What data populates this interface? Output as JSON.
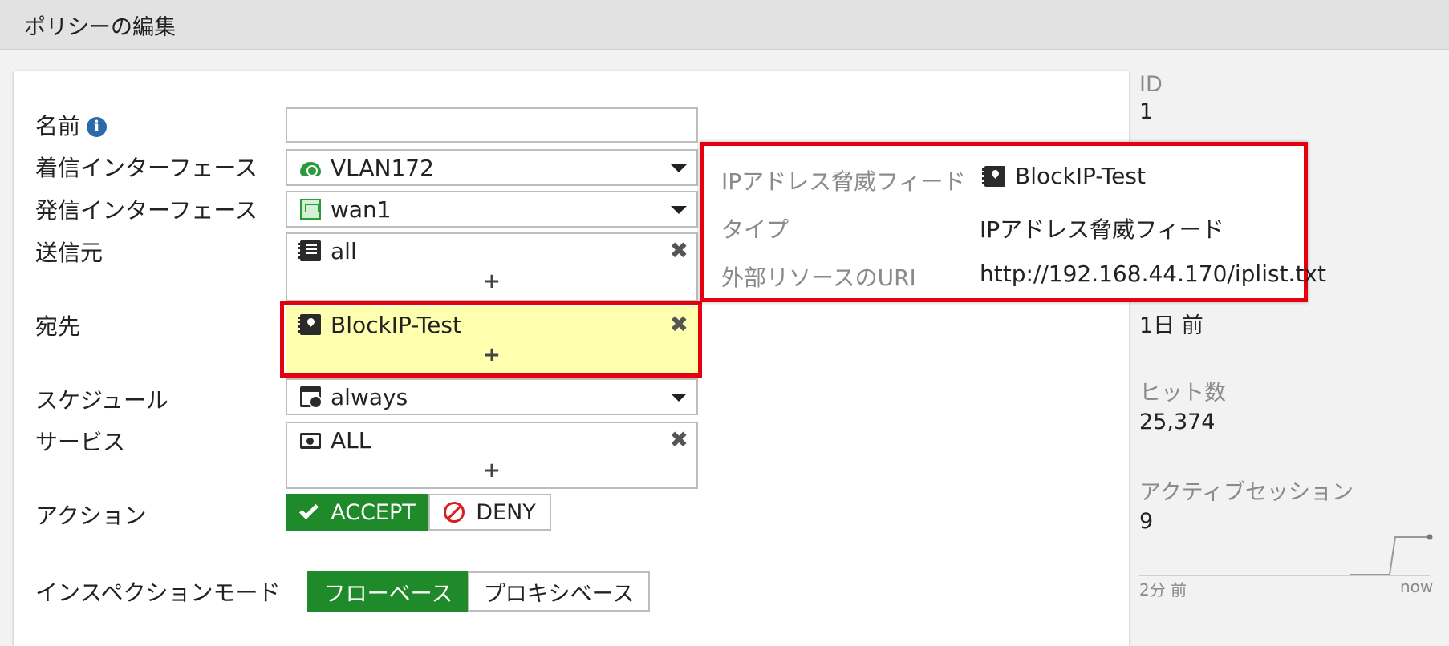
{
  "window": {
    "title": "ポリシーの編集"
  },
  "form": {
    "name": {
      "label": "名前",
      "value": ""
    },
    "incoming_interface": {
      "label": "着信インターフェース",
      "value": "VLAN172",
      "icon": "cloud-icon"
    },
    "outgoing_interface": {
      "label": "発信インターフェース",
      "value": "wan1",
      "icon": "port-icon"
    },
    "source": {
      "label": "送信元",
      "value": "all",
      "icon": "address-book-icon",
      "add": "+"
    },
    "destination": {
      "label": "宛先",
      "value": "BlockIP-Test",
      "icon": "threat-feed-icon",
      "add": "+",
      "highlight_color": "#ffffb0"
    },
    "schedule": {
      "label": "スケジュール",
      "value": "always",
      "icon": "schedule-icon"
    },
    "service": {
      "label": "サービス",
      "value": "ALL",
      "icon": "service-icon",
      "add": "+"
    },
    "action": {
      "label": "アクション",
      "accept": "ACCEPT",
      "deny": "DENY",
      "selected": "ACCEPT"
    },
    "inspection_mode": {
      "label": "インスペクションモード",
      "flow": "フローベース",
      "proxy": "プロキシベース",
      "selected": "フローベース"
    }
  },
  "tooltip": {
    "rows": [
      {
        "key": "IPアドレス脅威フィード",
        "value": "BlockIP-Test"
      },
      {
        "key": "タイプ",
        "value": "IPアドレス脅威フィード"
      },
      {
        "key": "外部リソースのURI",
        "value": "http://192.168.44.170/iplist.txt"
      }
    ]
  },
  "sidebar": {
    "id_label": "ID",
    "id_value": "1",
    "last_used_value": "1日 前",
    "hits_label": "ヒット数",
    "hits_value": "25,374",
    "sessions_label": "アクティブセッション",
    "sessions_value": "9",
    "spark_start": "2分 前",
    "spark_end": "now"
  },
  "colors": {
    "accent_green": "#1f8a2a",
    "highlight_red": "#e3000f"
  }
}
